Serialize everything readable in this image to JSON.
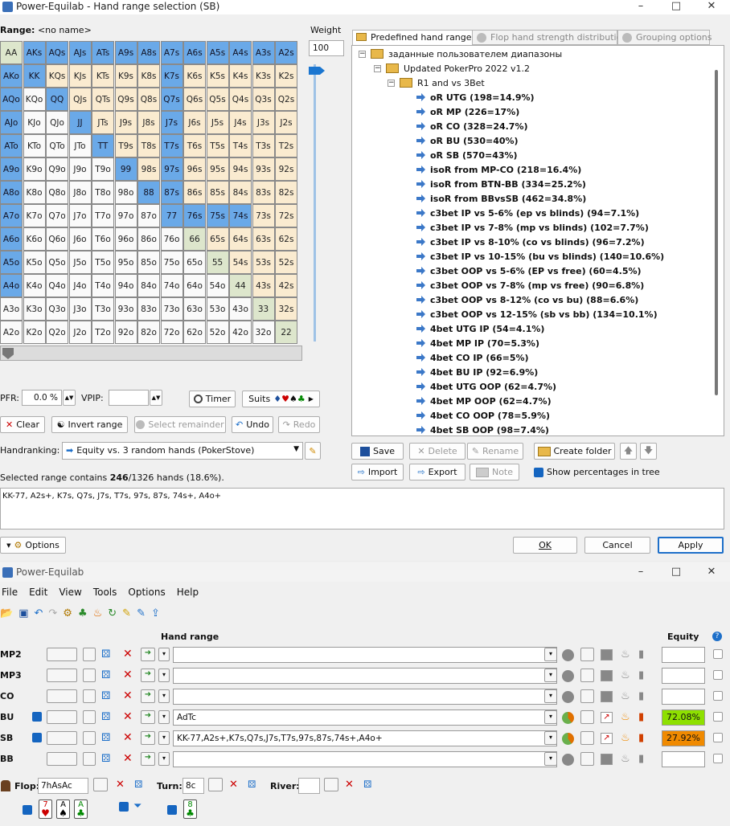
{
  "dialog": {
    "title": "Power-Equilab - Hand range selection (SB)",
    "range_label": "Range:",
    "range_name": "<no name>",
    "weight_label": "Weight",
    "weight_value": "100",
    "pfr_label": "PFR:",
    "pfr_value": "0.0 %",
    "vpip_label": "VPIP:",
    "vpip_value": "",
    "timer_label": "Timer",
    "suits_label": "Suits",
    "clear_label": "Clear",
    "invert_label": "Invert range",
    "select_remainder_label": "Select remainder",
    "undo_label": "Undo",
    "redo_label": "Redo",
    "handranking_label": "Handranking:",
    "handranking_value": "Equity vs. 3 random hands (PokerStove)",
    "selected_prefix": "Selected range contains",
    "selected_count": "246",
    "selected_suffix": "/1326 hands (18.6%).",
    "range_text": "KK-77, A2s+, K7s, Q7s, J7s, T7s, 97s, 87s, 74s+, A4o+",
    "options_label": "Options",
    "ok_label": "OK",
    "cancel_label": "Cancel",
    "apply_label": "Apply"
  },
  "grid": {
    "rows": [
      [
        "AA",
        "AKs",
        "AQs",
        "AJs",
        "ATs",
        "A9s",
        "A8s",
        "A7s",
        "A6s",
        "A5s",
        "A4s",
        "A3s",
        "A2s"
      ],
      [
        "AKo",
        "KK",
        "KQs",
        "KJs",
        "KTs",
        "K9s",
        "K8s",
        "K7s",
        "K6s",
        "K5s",
        "K4s",
        "K3s",
        "K2s"
      ],
      [
        "AQo",
        "KQo",
        "QQ",
        "QJs",
        "QTs",
        "Q9s",
        "Q8s",
        "Q7s",
        "Q6s",
        "Q5s",
        "Q4s",
        "Q3s",
        "Q2s"
      ],
      [
        "AJo",
        "KJo",
        "QJo",
        "JJ",
        "JTs",
        "J9s",
        "J8s",
        "J7s",
        "J6s",
        "J5s",
        "J4s",
        "J3s",
        "J2s"
      ],
      [
        "ATo",
        "KTo",
        "QTo",
        "JTo",
        "TT",
        "T9s",
        "T8s",
        "T7s",
        "T6s",
        "T5s",
        "T4s",
        "T3s",
        "T2s"
      ],
      [
        "A9o",
        "K9o",
        "Q9o",
        "J9o",
        "T9o",
        "99",
        "98s",
        "97s",
        "96s",
        "95s",
        "94s",
        "93s",
        "92s"
      ],
      [
        "A8o",
        "K8o",
        "Q8o",
        "J8o",
        "T8o",
        "98o",
        "88",
        "87s",
        "86s",
        "85s",
        "84s",
        "83s",
        "82s"
      ],
      [
        "A7o",
        "K7o",
        "Q7o",
        "J7o",
        "T7o",
        "97o",
        "87o",
        "77",
        "76s",
        "75s",
        "74s",
        "73s",
        "72s"
      ],
      [
        "A6o",
        "K6o",
        "Q6o",
        "J6o",
        "T6o",
        "96o",
        "86o",
        "76o",
        "66",
        "65s",
        "64s",
        "63s",
        "62s"
      ],
      [
        "A5o",
        "K5o",
        "Q5o",
        "J5o",
        "T5o",
        "95o",
        "85o",
        "75o",
        "65o",
        "55",
        "54s",
        "53s",
        "52s"
      ],
      [
        "A4o",
        "K4o",
        "Q4o",
        "J4o",
        "T4o",
        "94o",
        "84o",
        "74o",
        "64o",
        "54o",
        "44",
        "43s",
        "42s"
      ],
      [
        "A3o",
        "K3o",
        "Q3o",
        "J3o",
        "T3o",
        "93o",
        "83o",
        "73o",
        "63o",
        "53o",
        "43o",
        "33",
        "32s"
      ],
      [
        "A2o",
        "K2o",
        "Q2o",
        "J2o",
        "T2o",
        "92o",
        "82o",
        "72o",
        "62o",
        "52o",
        "42o",
        "32o",
        "22"
      ]
    ],
    "selected": [
      "AKs",
      "AQs",
      "AJs",
      "ATs",
      "A9s",
      "A8s",
      "A7s",
      "A6s",
      "A5s",
      "A4s",
      "A3s",
      "A2s",
      "AKo",
      "KK",
      "K7s",
      "AQo",
      "QQ",
      "Q7s",
      "AJo",
      "JJ",
      "J7s",
      "ATo",
      "TT",
      "T7s",
      "A9o",
      "99",
      "97s",
      "A8o",
      "88",
      "87s",
      "A7o",
      "77",
      "76s",
      "75s",
      "74s",
      "A6o",
      "A5o",
      "A4o"
    ]
  },
  "tabs": [
    "Predefined hand ranges",
    "Flop hand strength distribution",
    "Grouping options"
  ],
  "tree": {
    "root": "заданные пользователем диапазоны",
    "child": "Updated PokerPro 2022 v1.2",
    "group": "R1 and vs 3Bet",
    "items": [
      "oR UTG (198=14.9%)",
      "oR MP (226=17%)",
      "oR CO (328=24.7%)",
      "oR BU (530=40%)",
      "oR SB (570=43%)",
      "isoR from MP-CO (218=16.4%)",
      "isoR from BTN-BB (334=25.2%)",
      "isoR from BBvsSB (462=34.8%)",
      "c3bet IP vs 5-6% (ep vs blinds) (94=7.1%)",
      "c3bet IP vs 7-8% (mp vs blinds) (102=7.7%)",
      "c3bet IP vs 8-10% (co vs blinds) (96=7.2%)",
      "c3bet IP vs 10-15% (bu vs blinds) (140=10.6%)",
      "c3bet OOP vs 5-6% (EP vs free) (60=4.5%)",
      "c3bet OOP vs 7-8% (mp vs free) (90=6.8%)",
      "c3bet OOP vs 8-12% (co vs bu) (88=6.6%)",
      "c3bet OOP vs 12-15% (sb vs bb) (134=10.1%)",
      "4bet UTG IP (54=4.1%)",
      "4bet MP IP (70=5.3%)",
      "4bet CO IP (66=5%)",
      "4bet BU IP (92=6.9%)",
      "4bet UTG OOP (62=4.7%)",
      "4bet MP OOP (62=4.7%)",
      "4bet CO OOP (78=5.9%)",
      "4bet SB OOP (98=7.4%)"
    ]
  },
  "tree_buttons": {
    "save": "Save",
    "delete": "Delete",
    "rename": "Rename",
    "create_folder": "Create folder",
    "import": "Import",
    "export": "Export",
    "note": "Note",
    "show_pct": "Show percentages in tree"
  },
  "main": {
    "title": "Power-Equilab",
    "menu": [
      "File",
      "Edit",
      "View",
      "Tools",
      "Options",
      "Help"
    ],
    "hand_range_header": "Hand range",
    "equity_header": "Equity",
    "players": [
      {
        "pos": "MP2",
        "range": "",
        "equity": "",
        "active": false
      },
      {
        "pos": "MP3",
        "range": "",
        "equity": "",
        "active": false
      },
      {
        "pos": "CO",
        "range": "",
        "equity": "",
        "active": false
      },
      {
        "pos": "BU",
        "range": "AdTc",
        "equity": "72.08%",
        "active": true,
        "color": "#8ee000"
      },
      {
        "pos": "SB",
        "range": "KK-77,A2s+,K7s,Q7s,J7s,T7s,97s,87s,74s+,A4o+",
        "equity": "27.92%",
        "active": true,
        "color": "#f08a00"
      },
      {
        "pos": "BB",
        "range": "",
        "equity": "",
        "active": false
      }
    ],
    "flop_label": "Flop:",
    "flop_value": "7hAsAc",
    "turn_label": "Turn:",
    "turn_value": "8c",
    "river_label": "River:",
    "river_value": "",
    "flop_cards": [
      {
        "rank": "7",
        "suit": "♥",
        "color": "#c00"
      },
      {
        "rank": "A",
        "suit": "♠",
        "color": "#000"
      },
      {
        "rank": "A",
        "suit": "♣",
        "color": "#080"
      }
    ],
    "turn_cards": [
      {
        "rank": "8",
        "suit": "♣",
        "color": "#080"
      }
    ]
  }
}
